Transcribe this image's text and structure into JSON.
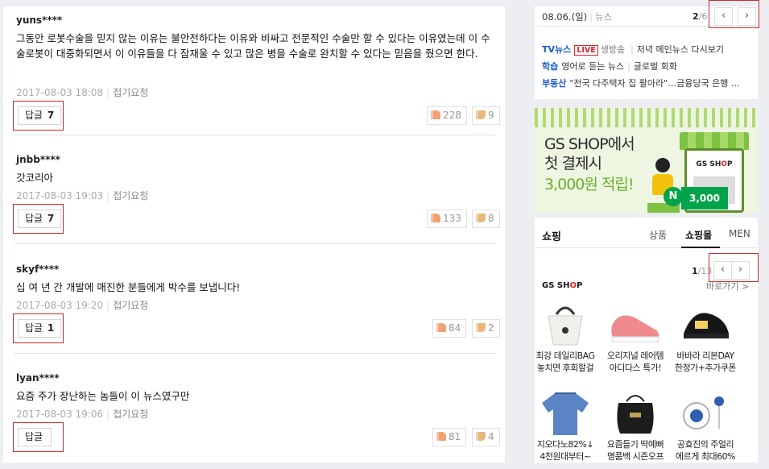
{
  "comments": [
    {
      "user": "yuns****",
      "body": "그동안 로봇수술을 믿지 않는 이유는 불안전하다는 이유와 비싸고 전문적인 수술만 할 수 있다는 이유였는데 이 수술로봇이 대중화되면서 이 이유들을 다 잠재울 수 있고 많은 병을 수술로 완치할 수 있다는 믿음을 줬으면 한다.",
      "date": "2017-08-03 18:08",
      "report": "접기요청",
      "reply_label": "답글",
      "reply_count": "7",
      "likes": "228",
      "dislikes": "9"
    },
    {
      "user": "jnbb****",
      "body": "갓코리아",
      "date": "2017-08-03 19:03",
      "report": "접기요청",
      "reply_label": "답글",
      "reply_count": "7",
      "likes": "133",
      "dislikes": "8"
    },
    {
      "user": "skyf****",
      "body": "십 여 년 간 개발에 매진한 분들에게 박수를 보냅니다!",
      "date": "2017-08-03 19:20",
      "report": "접기요청",
      "reply_label": "답글",
      "reply_count": "1",
      "likes": "84",
      "dislikes": "2"
    },
    {
      "user": "lyan****",
      "body": "요즘 주가 장난하는 놈들이 이 뉴스였구만",
      "date": "2017-08-03 19:06",
      "report": "접기요청",
      "reply_label": "답글",
      "reply_count": "",
      "likes": "81",
      "dislikes": "4"
    }
  ],
  "news": {
    "date": "08.06.(일)",
    "category": "뉴스",
    "page_current": "2",
    "page_total": "/6",
    "prev_icon": "chevron-left-icon",
    "next_icon": "chevron-right-icon",
    "lines": [
      {
        "tag": "TV뉴스",
        "live": "LIVE",
        "vod": "생방송",
        "text": "저녁 메인뉴스 다시보기"
      },
      {
        "tag": "학습",
        "text": "영어로 듣는 뉴스",
        "text2": "글로벌 회화"
      },
      {
        "tag": "부동산",
        "text": "\"전국 다주택자 집 팔아라\"…금융당국 은행 …"
      }
    ]
  },
  "ad": {
    "line1": "GS SHOP에서",
    "line2": "첫 결제시",
    "line3": "3,000원 적립!",
    "logo_text": "GS SH",
    "logo_o": "O",
    "logo_p": "P",
    "coin": "N",
    "amount": "3,000",
    "brand_color": "#01a44a"
  },
  "shopping": {
    "title": "쇼핑",
    "tabs": [
      "상품",
      "쇼핑몰",
      "MEN"
    ],
    "active_tab": "쇼핑몰",
    "page_current": "1",
    "page_total": "/13",
    "logo_text": "GS SH",
    "logo_o": "O",
    "logo_p": "P",
    "goto": "바로가기 >",
    "products": [
      {
        "line1": "최강 데일리BAG",
        "line2": "놓치면 후회할걸",
        "icon": "bag-icon"
      },
      {
        "line1": "오리지널 레어템",
        "line2": "아디다스 특가!",
        "icon": "sneaker-icon"
      },
      {
        "line1": "바바라 리본DAY",
        "line2": "한정가+추가쿠폰",
        "icon": "sandal-icon"
      },
      {
        "line1": "지오다노82%↓",
        "line2": "4천원대부터~",
        "icon": "shirt-icon"
      },
      {
        "line1": "요즘들기 딱예뻐",
        "line2": "명품백 시즌오프",
        "icon": "handbag-icon"
      },
      {
        "line1": "공효진의 주얼리",
        "line2": "에르게 최대60%",
        "icon": "jewelry-icon"
      }
    ]
  }
}
